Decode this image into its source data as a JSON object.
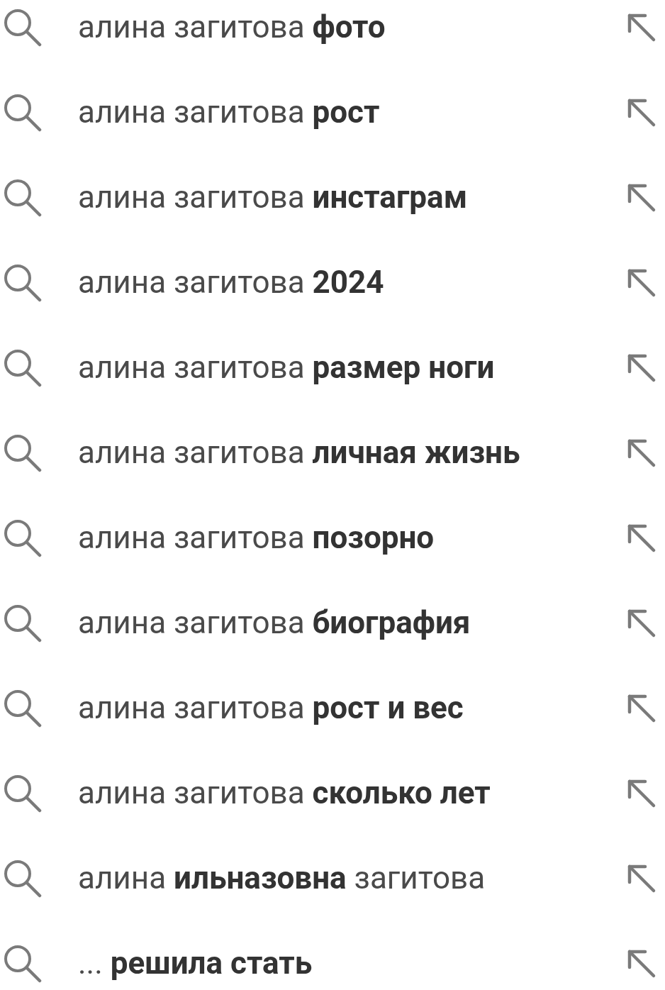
{
  "suggestions": [
    {
      "text": "алина загитова **фото**"
    },
    {
      "text": "алина загитова **рост**"
    },
    {
      "text": "алина загитова **инстаграм**"
    },
    {
      "text": "алина загитова **2024**"
    },
    {
      "text": "алина загитова **размер ноги**"
    },
    {
      "text": "алина загитова **личная жизнь**"
    },
    {
      "text": "алина загитова **позорно**"
    },
    {
      "text": "алина загитова **биография**"
    },
    {
      "text": "алина загитова **рост и вес**"
    },
    {
      "text": "алина загитова **сколько лет**"
    },
    {
      "text": "алина **ильназовна** загитова"
    },
    {
      "text": "... **решила стать**"
    }
  ]
}
